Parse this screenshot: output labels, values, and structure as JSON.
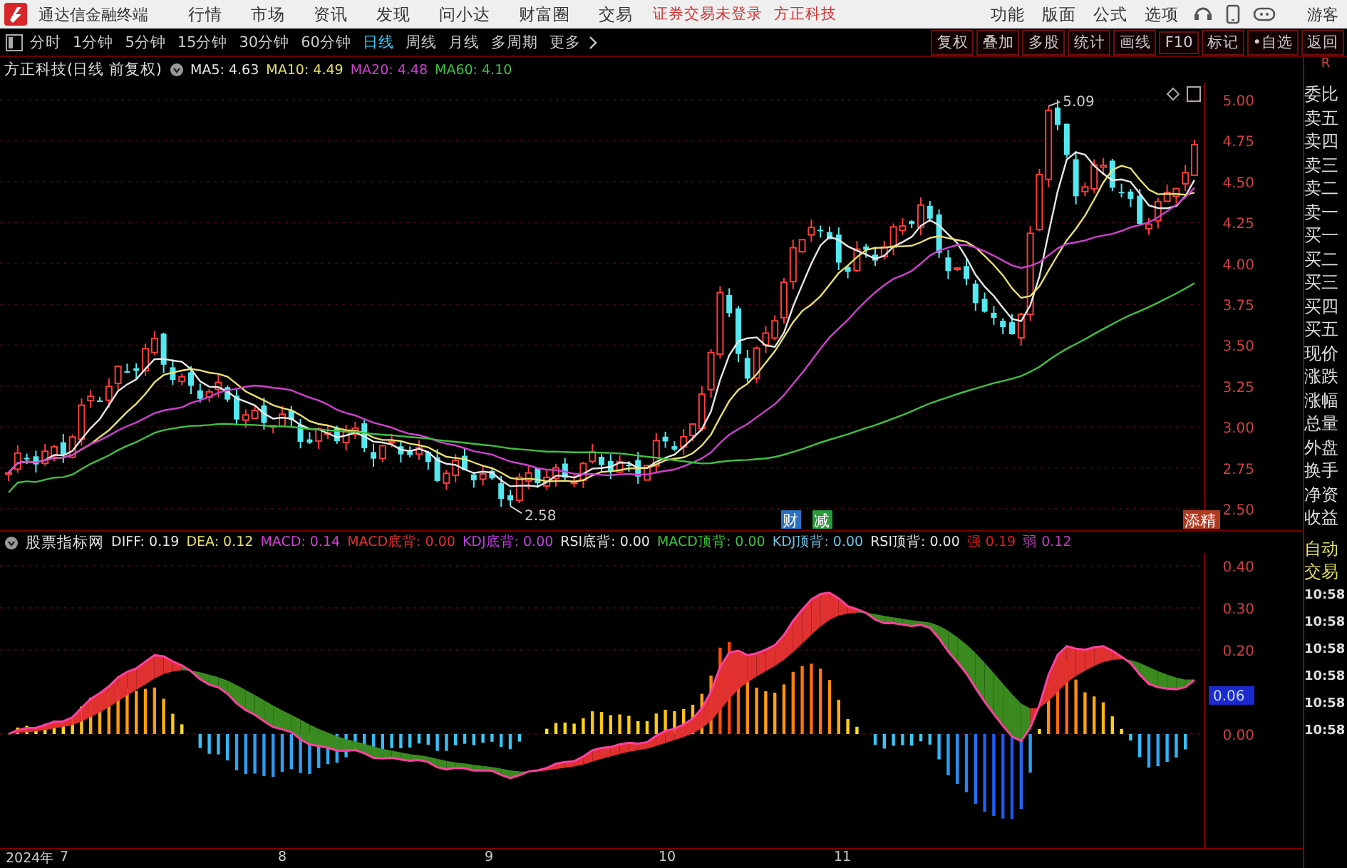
{
  "app": {
    "title": "通达信金融终端"
  },
  "menu": [
    "行情",
    "市场",
    "资讯",
    "发现",
    "问小达",
    "财富圈",
    "交易"
  ],
  "login_status": "证券交易未登录",
  "stock_link": "方正科技",
  "top_actions": [
    "功能",
    "版面",
    "公式",
    "选项"
  ],
  "user": "游客",
  "periods": [
    {
      "label": "分时",
      "selected": false
    },
    {
      "label": "1分钟",
      "selected": false
    },
    {
      "label": "5分钟",
      "selected": false
    },
    {
      "label": "15分钟",
      "selected": false
    },
    {
      "label": "30分钟",
      "selected": false
    },
    {
      "label": "60分钟",
      "selected": false
    },
    {
      "label": "日线",
      "selected": true
    },
    {
      "label": "周线",
      "selected": false
    },
    {
      "label": "月线",
      "selected": false
    },
    {
      "label": "多周期",
      "selected": false
    }
  ],
  "more": "更多",
  "tools": [
    "复权",
    "叠加",
    "多股",
    "统计",
    "画线",
    "F10",
    "标记",
    "•自选",
    "返回"
  ],
  "price_chart": {
    "title": "方正科技(日线 前复权)",
    "ma": [
      {
        "label": "MA5: 4.63",
        "color": "#e8e8e8"
      },
      {
        "label": "MA10: 4.49",
        "color": "#e8e070"
      },
      {
        "label": "MA20: 4.48",
        "color": "#d040d0"
      },
      {
        "label": "MA60: 4.10",
        "color": "#40c040"
      }
    ],
    "price_ticks": [
      "5.00",
      "4.75",
      "4.50",
      "4.25",
      "4.00",
      "3.75",
      "3.50",
      "3.25",
      "3.00",
      "2.75",
      "2.50"
    ],
    "high_label": "5.09",
    "low_label": "2.58",
    "markers": [
      {
        "text": "财",
        "color": "#2a6fc0"
      },
      {
        "text": "减",
        "color": "#2a9a3a"
      },
      {
        "text": "添精",
        "color": "#b03a20"
      }
    ]
  },
  "indicator": {
    "name": "股票指标网",
    "values": [
      {
        "label": "DIFF: 0.19",
        "color": "#e8e8e8"
      },
      {
        "label": "DEA: 0.12",
        "color": "#e8e070"
      },
      {
        "label": "MACD: 0.14",
        "color": "#d040d0"
      },
      {
        "label": "MACD底背: 0.00",
        "color": "#e03030"
      },
      {
        "label": "KDJ底背: 0.00",
        "color": "#c040e0"
      },
      {
        "label": "RSI底背: 0.00",
        "color": "#e8e8e8"
      },
      {
        "label": "MACD顶背: 0.00",
        "color": "#40c040"
      },
      {
        "label": "KDJ顶背: 0.00",
        "color": "#70c0e0"
      },
      {
        "label": "RSI顶背: 0.00",
        "color": "#e8e8e8"
      },
      {
        "label": "强 0.19",
        "color": "#e02020"
      },
      {
        "label": "弱 0.12",
        "color": "#c040c0"
      }
    ],
    "ticks": [
      "0.40",
      "0.30",
      "0.20",
      "0.00"
    ],
    "current_value": "0.06"
  },
  "date_axis": [
    "2024年",
    "7",
    "8",
    "9",
    "10",
    "11"
  ],
  "quote_panel": {
    "header": "R",
    "fields": [
      "委比",
      "卖五",
      "卖四",
      "卖三",
      "卖二",
      "卖一",
      "买一",
      "买二",
      "买三",
      "买四",
      "买五",
      "现价",
      "涨跌",
      "涨幅",
      "总量",
      "外盘",
      "换手",
      "净资",
      "收益"
    ]
  },
  "trade_panel": {
    "title": "自动交易",
    "times": [
      "10:58",
      "10:58",
      "10:58",
      "10:58",
      "10:58",
      "10:58"
    ]
  }
}
